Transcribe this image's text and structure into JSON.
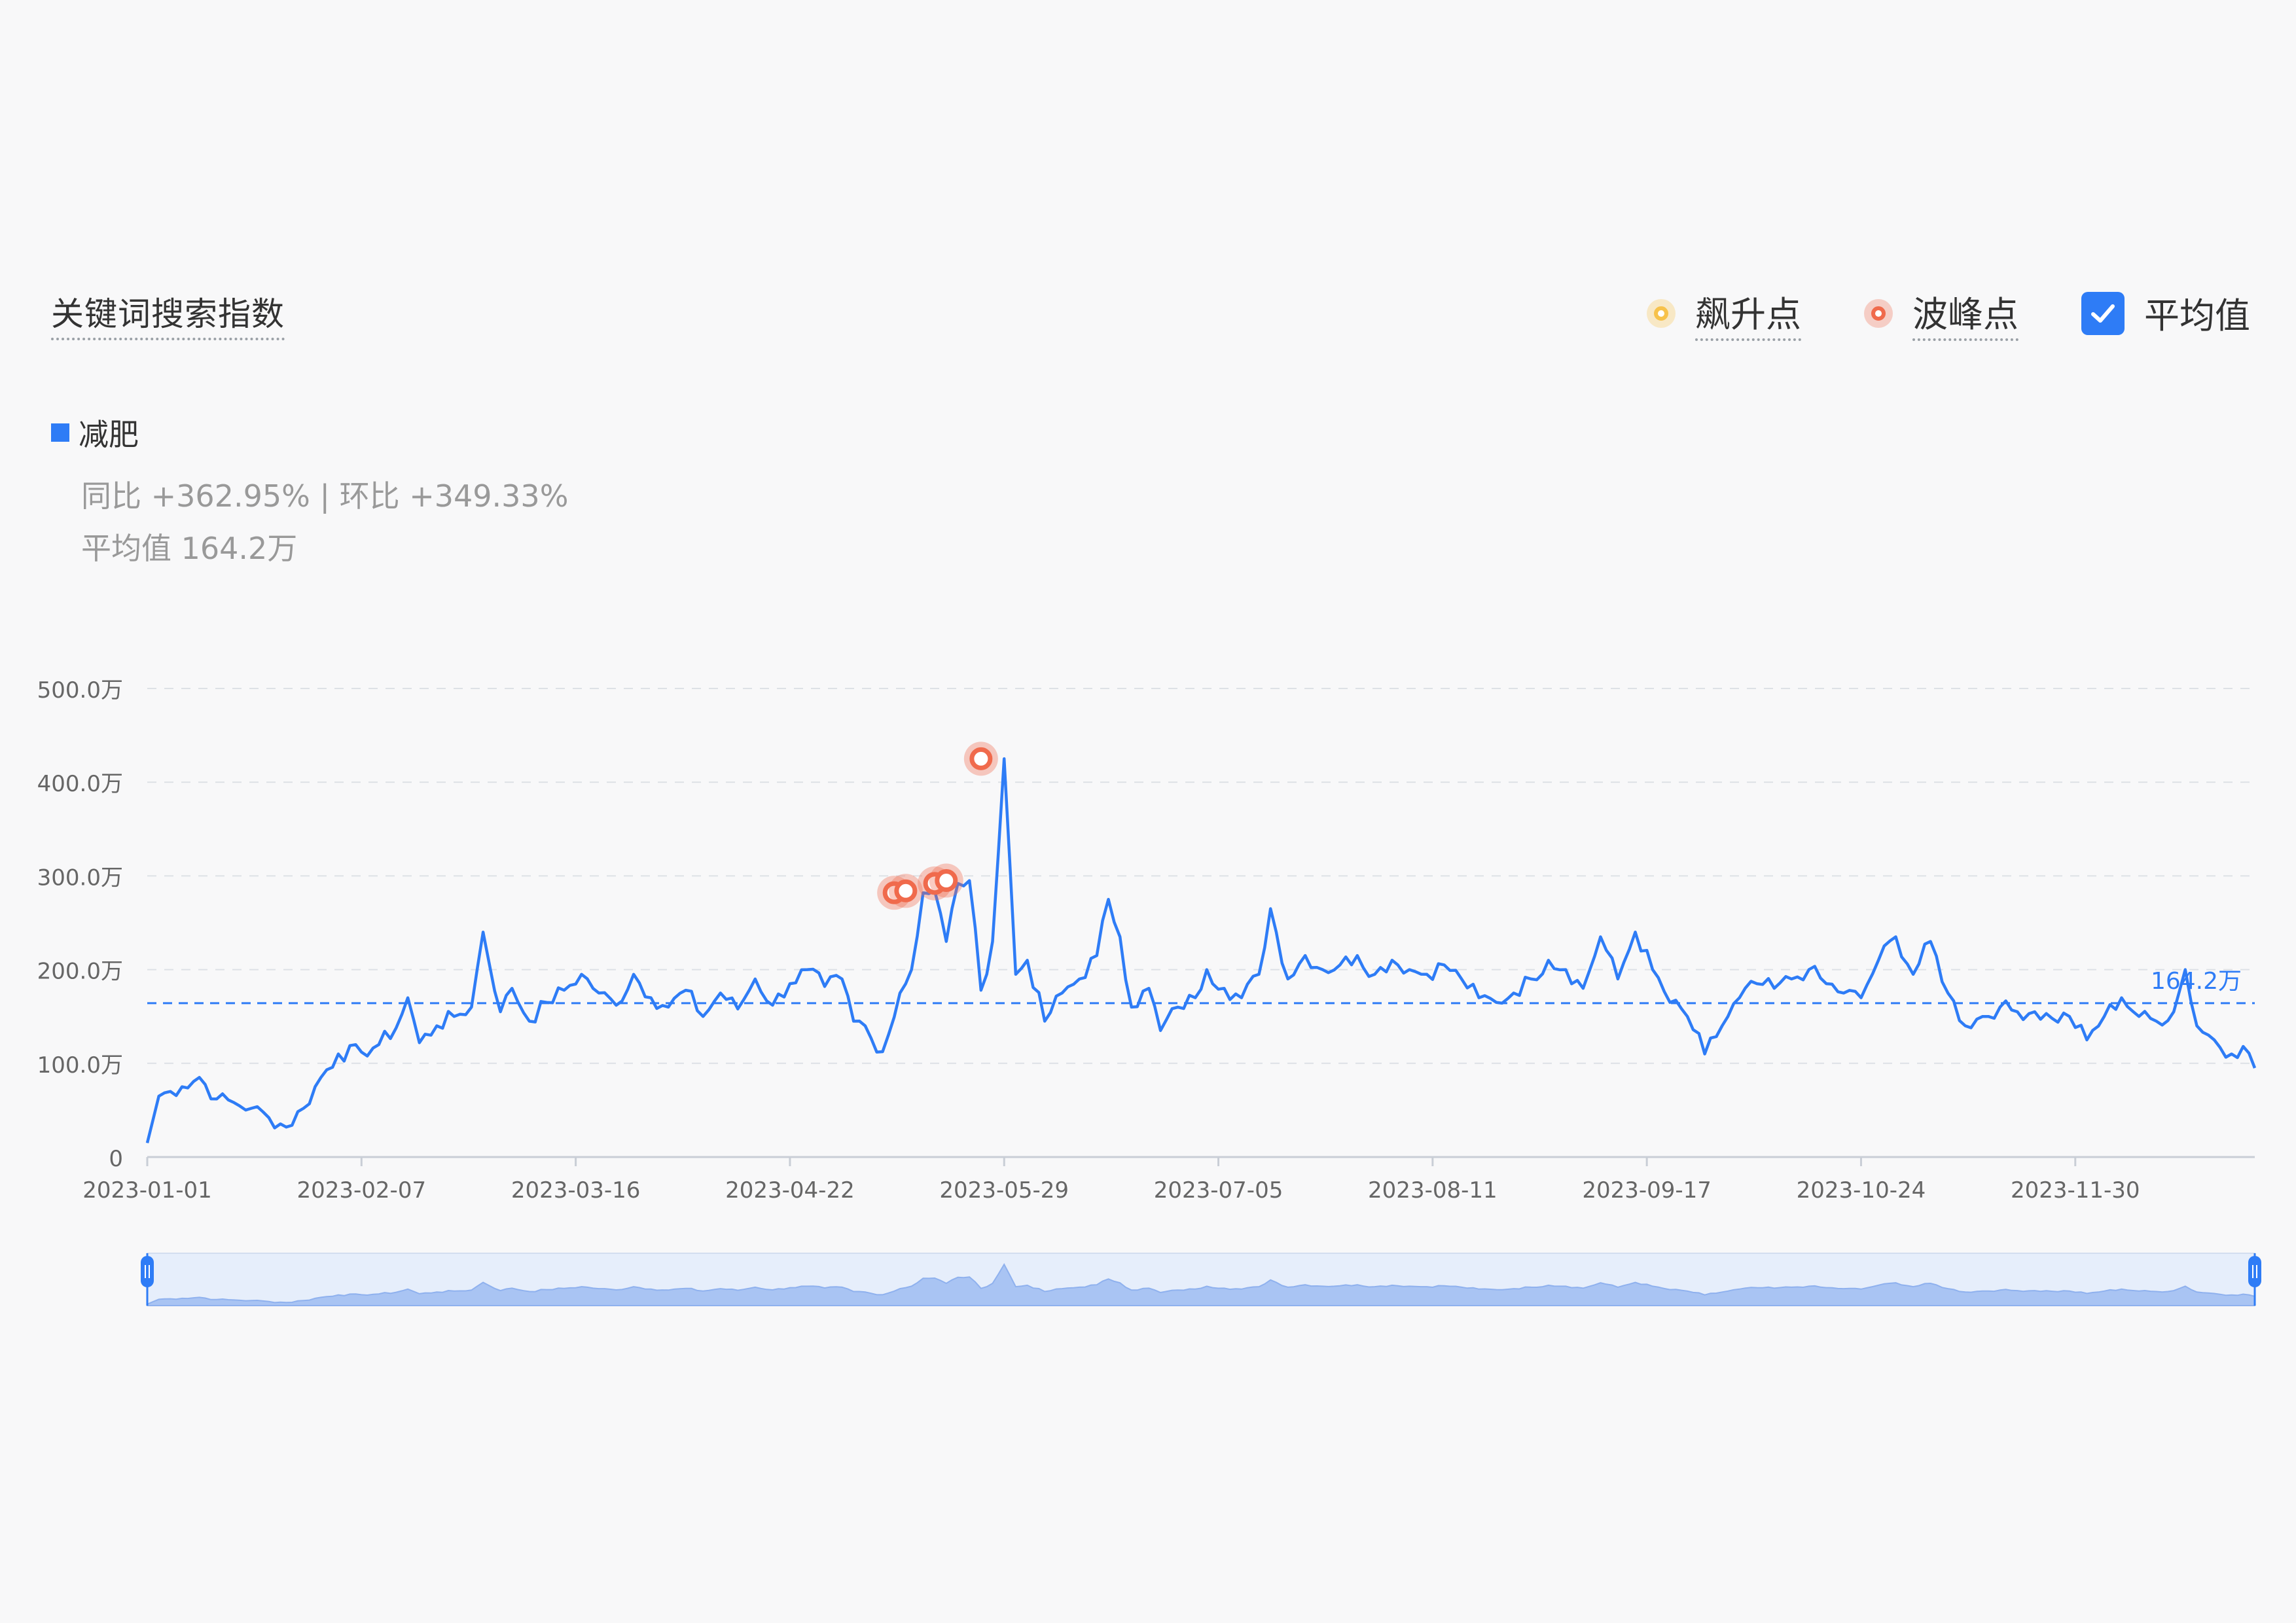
{
  "title": "关键词搜索指数",
  "legend_top": {
    "rise_label": "飙升点",
    "peak_label": "波峰点",
    "avg_label": "平均值",
    "avg_checked": true
  },
  "series_label": "减肥",
  "stats": {
    "line1": "同比 +362.95% | 环比 +349.33%",
    "line2": "平均值 164.2万"
  },
  "colors": {
    "line": "#2e7cf6",
    "rise": "#f7c24b",
    "peak": "#f06a4c",
    "grid": "#dde1e6",
    "avg": "#2e7cf6"
  },
  "chart_data": {
    "type": "line",
    "series": [
      {
        "name": "减肥",
        "values": []
      }
    ],
    "x_tick_labels": [
      "2023-01-01",
      "2023-02-07",
      "2023-03-16",
      "2023-04-22",
      "2023-05-29",
      "2023-07-05",
      "2023-08-11",
      "2023-09-17",
      "2023-10-24",
      "2023-11-30"
    ],
    "y_tick_labels": [
      "0",
      "100.0万",
      "200.0万",
      "300.0万",
      "400.0万",
      "500.0万"
    ],
    "ylim": [
      0,
      500
    ],
    "y_unit": "万",
    "average": 164.2,
    "average_label": "164.2万",
    "x_start": "2023-01-01",
    "x_end": "2023-12-31",
    "peak_points": [
      {
        "date": "2023-05-10",
        "value": 282
      },
      {
        "date": "2023-05-12",
        "value": 284
      },
      {
        "date": "2023-05-17",
        "value": 292
      },
      {
        "date": "2023-05-19",
        "value": 295
      },
      {
        "date": "2023-05-25",
        "value": 425
      }
    ],
    "daily_values_keyframes": [
      [
        "2023-01-01",
        15
      ],
      [
        "2023-01-03",
        65
      ],
      [
        "2023-01-05",
        70
      ],
      [
        "2023-01-07",
        75
      ],
      [
        "2023-01-10",
        85
      ],
      [
        "2023-01-13",
        62
      ],
      [
        "2023-01-16",
        58
      ],
      [
        "2023-01-19",
        52
      ],
      [
        "2023-01-22",
        42
      ],
      [
        "2023-01-25",
        32
      ],
      [
        "2023-01-28",
        52
      ],
      [
        "2023-01-31",
        85
      ],
      [
        "2023-02-03",
        110
      ],
      [
        "2023-02-07",
        112
      ],
      [
        "2023-02-10",
        120
      ],
      [
        "2023-02-13",
        138
      ],
      [
        "2023-02-15",
        170
      ],
      [
        "2023-02-17",
        122
      ],
      [
        "2023-02-20",
        140
      ],
      [
        "2023-02-23",
        150
      ],
      [
        "2023-02-26",
        160
      ],
      [
        "2023-02-28",
        240
      ],
      [
        "2023-03-03",
        155
      ],
      [
        "2023-03-05",
        180
      ],
      [
        "2023-03-08",
        145
      ],
      [
        "2023-03-11",
        165
      ],
      [
        "2023-03-14",
        178
      ],
      [
        "2023-03-17",
        195
      ],
      [
        "2023-03-20",
        175
      ],
      [
        "2023-03-23",
        162
      ],
      [
        "2023-03-26",
        195
      ],
      [
        "2023-03-29",
        170
      ],
      [
        "2023-04-01",
        160
      ],
      [
        "2023-04-04",
        178
      ],
      [
        "2023-04-07",
        150
      ],
      [
        "2023-04-10",
        175
      ],
      [
        "2023-04-13",
        158
      ],
      [
        "2023-04-16",
        190
      ],
      [
        "2023-04-19",
        162
      ],
      [
        "2023-04-22",
        185
      ],
      [
        "2023-04-25",
        200
      ],
      [
        "2023-04-28",
        182
      ],
      [
        "2023-05-01",
        190
      ],
      [
        "2023-05-03",
        145
      ],
      [
        "2023-05-05",
        140
      ],
      [
        "2023-05-07",
        112
      ],
      [
        "2023-05-09",
        130
      ],
      [
        "2023-05-11",
        175
      ],
      [
        "2023-05-13",
        200
      ],
      [
        "2023-05-15",
        282
      ],
      [
        "2023-05-17",
        284
      ],
      [
        "2023-05-19",
        230
      ],
      [
        "2023-05-21",
        292
      ],
      [
        "2023-05-23",
        295
      ],
      [
        "2023-05-25",
        178
      ],
      [
        "2023-05-27",
        230
      ],
      [
        "2023-05-29",
        425
      ],
      [
        "2023-05-31",
        195
      ],
      [
        "2023-06-02",
        210
      ],
      [
        "2023-06-05",
        145
      ],
      [
        "2023-06-08",
        175
      ],
      [
        "2023-06-11",
        190
      ],
      [
        "2023-06-14",
        215
      ],
      [
        "2023-06-16",
        275
      ],
      [
        "2023-06-18",
        235
      ],
      [
        "2023-06-20",
        160
      ],
      [
        "2023-06-23",
        180
      ],
      [
        "2023-06-25",
        135
      ],
      [
        "2023-06-28",
        160
      ],
      [
        "2023-07-01",
        170
      ],
      [
        "2023-07-03",
        200
      ],
      [
        "2023-07-06",
        180
      ],
      [
        "2023-07-09",
        170
      ],
      [
        "2023-07-12",
        195
      ],
      [
        "2023-07-14",
        265
      ],
      [
        "2023-07-17",
        190
      ],
      [
        "2023-07-20",
        215
      ],
      [
        "2023-07-23",
        200
      ],
      [
        "2023-07-26",
        205
      ],
      [
        "2023-07-29",
        215
      ],
      [
        "2023-08-01",
        195
      ],
      [
        "2023-08-04",
        210
      ],
      [
        "2023-08-07",
        200
      ],
      [
        "2023-08-10",
        195
      ],
      [
        "2023-08-13",
        205
      ],
      [
        "2023-08-16",
        190
      ],
      [
        "2023-08-19",
        170
      ],
      [
        "2023-08-22",
        165
      ],
      [
        "2023-08-25",
        175
      ],
      [
        "2023-08-28",
        190
      ],
      [
        "2023-08-31",
        210
      ],
      [
        "2023-09-03",
        200
      ],
      [
        "2023-09-06",
        180
      ],
      [
        "2023-09-09",
        235
      ],
      [
        "2023-09-12",
        190
      ],
      [
        "2023-09-15",
        240
      ],
      [
        "2023-09-18",
        200
      ],
      [
        "2023-09-21",
        165
      ],
      [
        "2023-09-24",
        150
      ],
      [
        "2023-09-27",
        110
      ],
      [
        "2023-09-30",
        140
      ],
      [
        "2023-10-03",
        170
      ],
      [
        "2023-10-06",
        185
      ],
      [
        "2023-10-09",
        180
      ],
      [
        "2023-10-12",
        190
      ],
      [
        "2023-10-15",
        200
      ],
      [
        "2023-10-18",
        185
      ],
      [
        "2023-10-21",
        175
      ],
      [
        "2023-10-24",
        170
      ],
      [
        "2023-10-27",
        210
      ],
      [
        "2023-10-30",
        235
      ],
      [
        "2023-11-02",
        195
      ],
      [
        "2023-11-05",
        230
      ],
      [
        "2023-11-08",
        175
      ],
      [
        "2023-11-11",
        140
      ],
      [
        "2023-11-14",
        150
      ],
      [
        "2023-11-17",
        160
      ],
      [
        "2023-11-20",
        155
      ],
      [
        "2023-11-23",
        155
      ],
      [
        "2023-11-26",
        148
      ],
      [
        "2023-11-29",
        150
      ],
      [
        "2023-12-02",
        125
      ],
      [
        "2023-12-05",
        150
      ],
      [
        "2023-12-08",
        170
      ],
      [
        "2023-12-11",
        150
      ],
      [
        "2023-12-14",
        145
      ],
      [
        "2023-12-17",
        155
      ],
      [
        "2023-12-19",
        200
      ],
      [
        "2023-12-21",
        140
      ],
      [
        "2023-12-24",
        125
      ],
      [
        "2023-12-27",
        110
      ],
      [
        "2023-12-29",
        118
      ],
      [
        "2023-12-31",
        95
      ]
    ]
  }
}
